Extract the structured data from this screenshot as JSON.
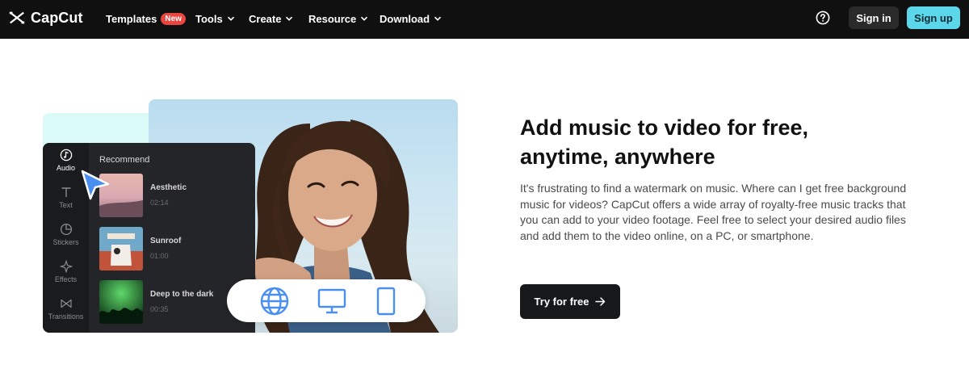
{
  "brand": {
    "name": "CapCut"
  },
  "nav": {
    "items": [
      {
        "label": "Templates",
        "badge": "New",
        "chevron": false
      },
      {
        "label": "Tools",
        "chevron": true
      },
      {
        "label": "Create",
        "chevron": true
      },
      {
        "label": "Resource",
        "chevron": true
      },
      {
        "label": "Download",
        "chevron": true
      }
    ],
    "help_icon": "question-circle-icon",
    "signin_label": "Sign in",
    "signup_label": "Sign up"
  },
  "editor_panel": {
    "sidebar": [
      {
        "label": "Audio",
        "icon": "music-note-icon",
        "active": true
      },
      {
        "label": "Text",
        "icon": "text-icon",
        "active": false
      },
      {
        "label": "Stickers",
        "icon": "sticker-icon",
        "active": false
      },
      {
        "label": "Effects",
        "icon": "sparkle-icon",
        "active": false
      },
      {
        "label": "Transitions",
        "icon": "transition-icon",
        "active": false
      }
    ],
    "section_title": "Recommend",
    "tracks": [
      {
        "name": "Aesthetic",
        "duration": "02:14"
      },
      {
        "name": "Sunroof",
        "duration": "01:00"
      },
      {
        "name": "Deep to the dark",
        "duration": "00:35"
      }
    ]
  },
  "devices": [
    "globe-icon",
    "monitor-icon",
    "tablet-icon"
  ],
  "hero": {
    "headline": "Add music to video for free, anytime, anywhere",
    "description": "It's frustrating to find a watermark on music. Where can I get free background music for videos? CapCut offers a wide array of royalty-free music tracks that you can add to your video footage. Feel free to select your desired audio files and add them to the video online, on a PC, or smartphone.",
    "cta_label": "Try for free"
  },
  "colors": {
    "nav_bg": "#101010",
    "signup_bg": "#5bd6ea",
    "badge_bg": "#e8463f",
    "cta_bg": "#17181a",
    "device_icon": "#4a8ff0"
  }
}
